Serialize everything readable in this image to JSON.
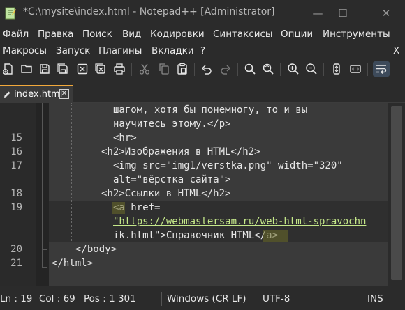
{
  "window": {
    "title": "*C:\\mysite\\index.html - Notepad++ [Administrator]",
    "minimize": "—",
    "maximize": "☐",
    "close": "✕"
  },
  "menu": {
    "row1": [
      "Файл",
      "Правка",
      "Поиск",
      "Вид",
      "Кодировки",
      "Синтаксисы",
      "Опции",
      "Инструменты"
    ],
    "row2": [
      "Макросы",
      "Запуск",
      "Плагины",
      "Вкладки",
      "?"
    ],
    "close_doc": "X"
  },
  "toolbar_icons": [
    "new-file",
    "open-file",
    "save",
    "save-all",
    "close",
    "close-all",
    "print",
    "cut",
    "copy",
    "paste",
    "undo",
    "redo",
    "find",
    "replace",
    "zoom-in",
    "zoom-out",
    "sync-scroll",
    "word-wrap",
    "show-all-chars"
  ],
  "tab": {
    "label": "index.html",
    "close": "✕"
  },
  "editor": {
    "lines": [
      {
        "num": "",
        "text": "шагом, хотя бы понемногу, то и вы"
      },
      {
        "num": "",
        "text": "научитесь этому.</p>"
      },
      {
        "num": "15",
        "text": "<hr>"
      },
      {
        "num": "16",
        "text": "<h2>Изображения в HTML</h2>"
      },
      {
        "num": "17",
        "text": "<img src=\"img1/verstka.png\" width=\"320\""
      },
      {
        "num": "",
        "text": "alt=\"вёрстка сайта\">"
      },
      {
        "num": "18",
        "text": "<h2>Ссылки в HTML</h2>"
      },
      {
        "num": "19",
        "text": "<a href="
      },
      {
        "num": "",
        "text": "\"https://webmastersam.ru/web-html-spravochn"
      },
      {
        "num": "",
        "text": "ik.html\">Справочник HTML</a>"
      },
      {
        "num": "20",
        "text": "</body>"
      },
      {
        "num": "21",
        "text": "</html>"
      }
    ]
  },
  "status": {
    "ln": "Ln : 19",
    "col": "Col : 69",
    "pos": "Pos : 1 301",
    "eol": "Windows (CR LF)",
    "encoding": "UTF-8",
    "mode": "INS"
  }
}
